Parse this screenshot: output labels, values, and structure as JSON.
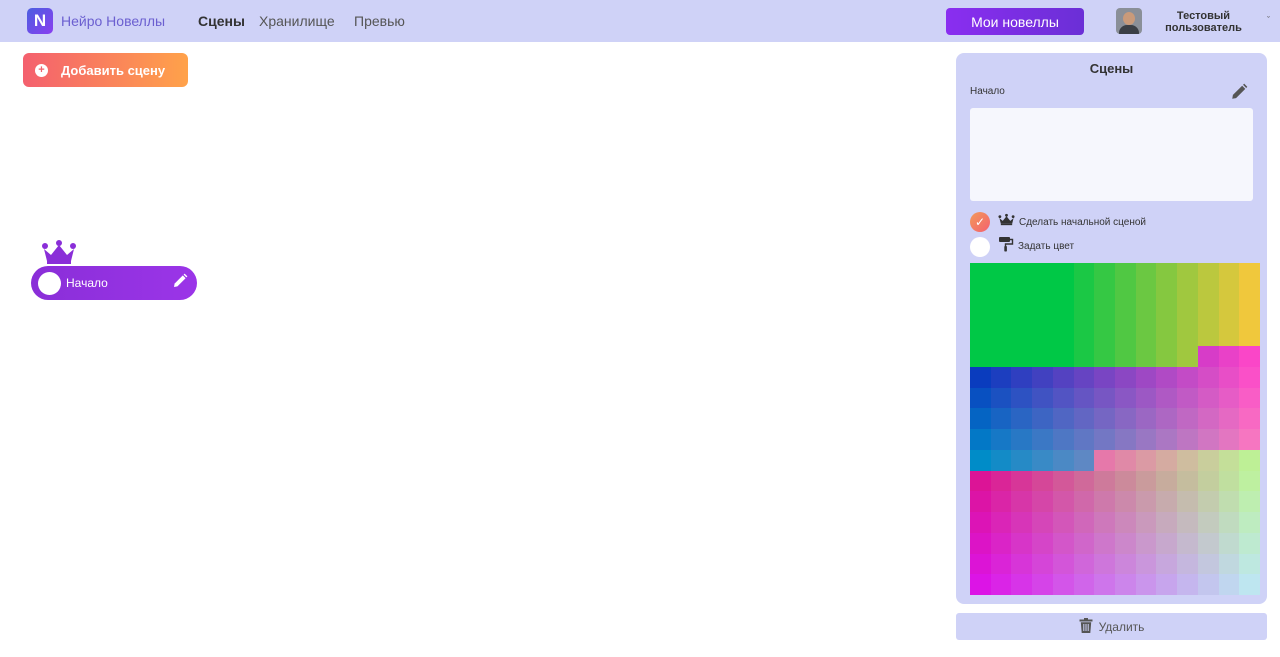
{
  "app": {
    "logo_letter": "N",
    "brand": "Нейро Новеллы"
  },
  "nav": {
    "items": [
      {
        "label": "Сцены",
        "active": true
      },
      {
        "label": "Хранилище",
        "active": false
      },
      {
        "label": "Превью",
        "active": false
      }
    ]
  },
  "header": {
    "my_novels_label": "Мои новеллы",
    "user_name_line1": "Тестовый",
    "user_name_line2": "пользователь",
    "caret": "ˇ"
  },
  "toolbar": {
    "add_scene_label": "Добавить сцену",
    "add_icon": "plus-circle-icon"
  },
  "canvas": {
    "nodes": [
      {
        "label": "Начало",
        "is_start": true,
        "color": "#ffffff"
      }
    ]
  },
  "panel": {
    "title": "Сцены",
    "scene_name": "Начало",
    "description_value": "",
    "make_start_label": "Сделать начальной сценой",
    "make_start_checked": true,
    "set_color_label": "Задать цвет",
    "selected_color": "#ffffff",
    "delete_label": "Удалить"
  },
  "colors": {
    "accent": "#8a2ed8",
    "topbar": "#cfd2f7",
    "add_gradient_from": "#f4606e",
    "add_gradient_to": "#ffa24a"
  }
}
